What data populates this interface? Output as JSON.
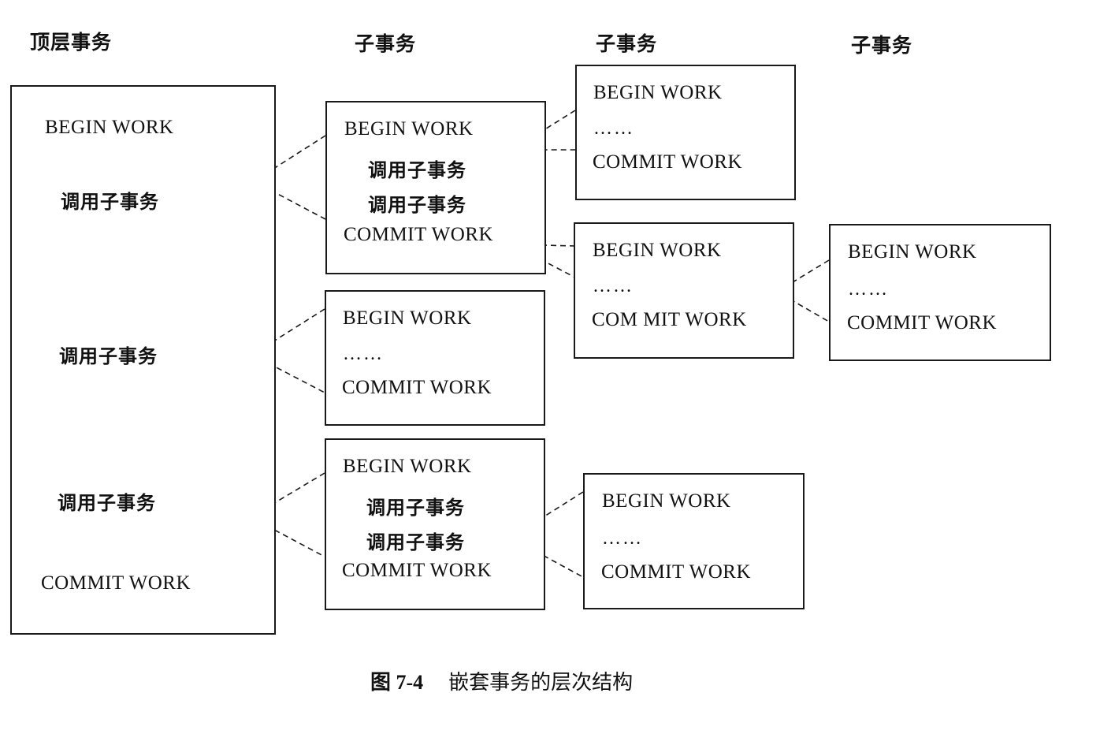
{
  "headers": {
    "top": "顶层事务",
    "sub1": "子事务",
    "sub2": "子事务",
    "sub3": "子事务"
  },
  "top_box": {
    "begin": "BEGIN WORK",
    "call1": "调用子事务",
    "call2": "调用子事务",
    "call3": "调用子事务",
    "commit": "COMMIT WORK"
  },
  "sub_a": {
    "begin": "BEGIN WORK",
    "call1": "调用子事务",
    "call2": "调用子事务",
    "commit": "COMMIT WORK"
  },
  "sub_b": {
    "begin": "BEGIN WORK",
    "dots": "……",
    "commit": "COMMIT WORK"
  },
  "sub_c": {
    "begin": "BEGIN WORK",
    "call1": "调用子事务",
    "call2": "调用子事务",
    "commit": "COMMIT WORK"
  },
  "sub_a1": {
    "begin": "BEGIN WORK",
    "dots": "……",
    "commit": "COMMIT WORK"
  },
  "sub_a2": {
    "begin": "BEGIN WORK",
    "dots": "……",
    "commit": "COM MIT WORK"
  },
  "sub_a2_child": {
    "begin": "BEGIN WORK",
    "dots": "……",
    "commit": "COMMIT WORK"
  },
  "sub_c1": {
    "begin": "BEGIN WORK",
    "dots": "……",
    "commit": "COMMIT WORK"
  },
  "caption": {
    "number": "图 7-4",
    "title": "嵌套事务的层次结构"
  }
}
